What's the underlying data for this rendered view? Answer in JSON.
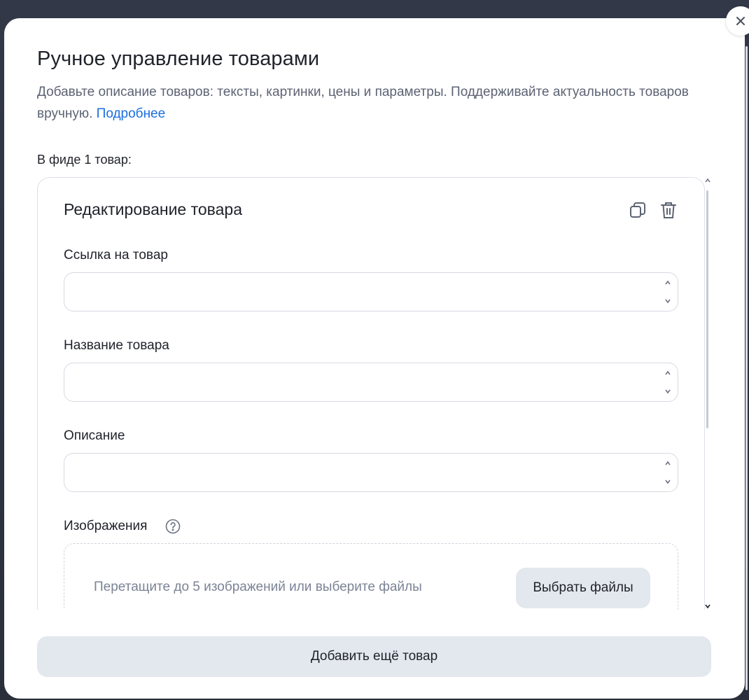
{
  "modal": {
    "title": "Ручное управление товарами",
    "description": "Добавьте описание товаров: тексты, картинки, цены и параметры. Поддерживайте актуальность товаров вручную.",
    "more_link": "Подробнее",
    "feed_count": "В фиде 1 товар:",
    "close_icon": "close-icon"
  },
  "card": {
    "title": "Редактирование товара",
    "copy_icon": "copy-icon",
    "delete_icon": "trash-icon",
    "fields": [
      {
        "label": "Ссылка на товар",
        "value": "",
        "placeholder": ""
      },
      {
        "label": "Название товара",
        "value": "",
        "placeholder": ""
      },
      {
        "label": "Описание",
        "value": "",
        "placeholder": ""
      }
    ],
    "images": {
      "label": "Изображения",
      "help_icon": "question-circle-icon",
      "dropzone_text": "Перетащите до 5 изображений или выберите файлы",
      "choose_button": "Выбрать файлы"
    }
  },
  "footer": {
    "add_more_button": "Добавить ещё товар"
  },
  "colors": {
    "link": "#1a6fe0",
    "secondary_button_bg": "#e3e7ee",
    "text_primary": "#1f2229",
    "text_secondary": "#5c6373",
    "border": "#d6dae2"
  }
}
